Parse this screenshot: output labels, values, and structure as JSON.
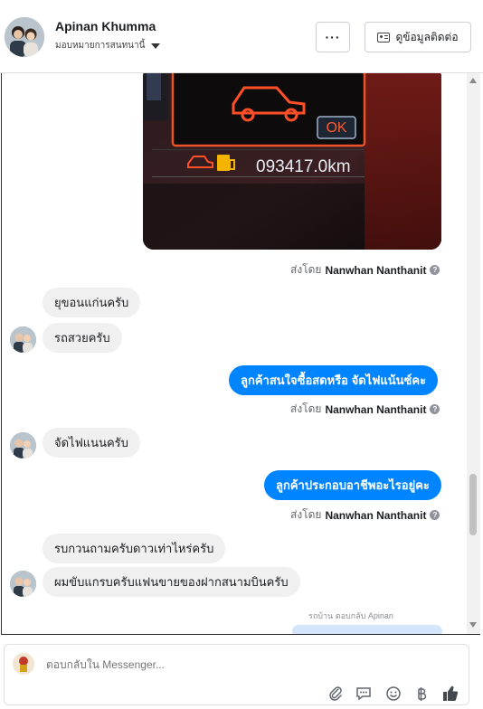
{
  "header": {
    "name": "Apinan Khumma",
    "assign_label": "มอบหมายการสนทนานี้",
    "more_label": "···",
    "contact_label": "ดูข้อมูลติดต่อ"
  },
  "photo": {
    "odometer": "093417.0km",
    "ok_label": "OK"
  },
  "messages": [
    {
      "dir": "out-note",
      "sent_prefix": "ส่งโดย",
      "sender": "Nanwhan Nanthanit"
    },
    {
      "dir": "in",
      "text": "ยุขอนแก่นครับ"
    },
    {
      "dir": "in",
      "text": "รถสวยครับ"
    },
    {
      "dir": "out",
      "text": "ลูกค้าสนใจซื้อสดหรือ จัดไฟแน้นซ์คะ"
    },
    {
      "dir": "out-note",
      "sent_prefix": "ส่งโดย",
      "sender": "Nanwhan Nanthanit"
    },
    {
      "dir": "in",
      "text": "จัดไฟแนนครับ"
    },
    {
      "dir": "out",
      "text": "ลูกค้าประกอบอาชีพอะไรอยู่คะ"
    },
    {
      "dir": "out-note",
      "sent_prefix": "ส่งโดย",
      "sender": "Nanwhan Nanthanit"
    },
    {
      "dir": "in",
      "text": "รบกวนถามครับดาวเท่าไหร่ครับ"
    },
    {
      "dir": "in",
      "text": "ผมขับแกรบครับแฟนขายของฝากสนามบินครับ"
    }
  ],
  "reply_note": "ตอบกลับ Apinan",
  "reply_note_prefix": "รถบ้าน",
  "composer": {
    "placeholder": "ตอบกลับใน Messenger...",
    "tools": [
      "attach-icon",
      "sticker-icon",
      "emoji-icon",
      "baht-icon",
      "like-icon"
    ]
  },
  "colors": {
    "outgoing_bubble": "#0084ff",
    "incoming_bubble": "#f0f0f0"
  }
}
